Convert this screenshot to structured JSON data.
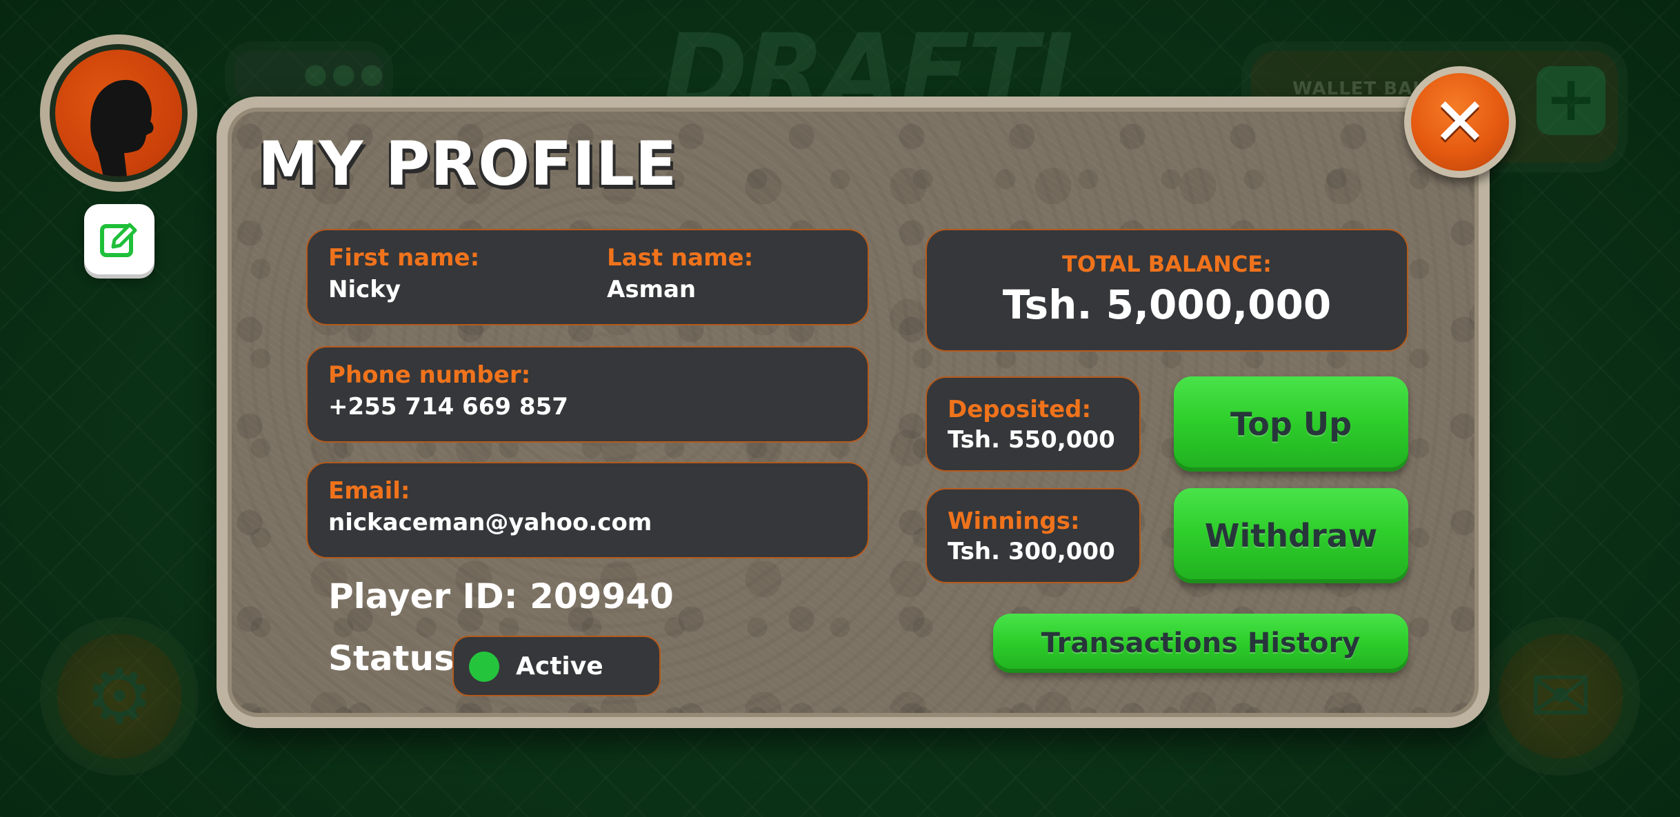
{
  "background": {
    "logo_text": "DRAFTI",
    "wallet_label": "WALLET BALA",
    "wallet_plus": "+"
  },
  "profile": {
    "title": "MY PROFILE",
    "first_name_label": "First name:",
    "first_name": "Nicky",
    "last_name_label": "Last name:",
    "last_name": "Asman",
    "phone_label": "Phone number:",
    "phone": "+255 714 669 857",
    "email_label": "Email:",
    "email": "nickaceman@yahoo.com",
    "player_id_label": "Player ID:",
    "player_id": "209940",
    "status_label": "Status:",
    "status": "Active"
  },
  "wallet": {
    "total_balance_label": "TOTAL BALANCE:",
    "total_balance": "Tsh. 5,000,000",
    "deposited_label": "Deposited:",
    "deposited": "Tsh. 550,000",
    "winnings_label": "Winnings:",
    "winnings": "Tsh. 300,000"
  },
  "buttons": {
    "top_up": "Top Up",
    "withdraw": "Withdraw",
    "transactions_history": "Transactions History",
    "close": "✕"
  },
  "colors": {
    "accent_orange": "#f0731c",
    "card_bg": "#35373a",
    "button_green": "#2fcf2c",
    "status_active": "#25c43d",
    "close_orange": "#e55a10"
  },
  "icons": {
    "edit": "edit-icon",
    "close": "close-icon",
    "settings": "gear-icon",
    "mail": "mail-icon",
    "status": "status-dot-icon"
  }
}
